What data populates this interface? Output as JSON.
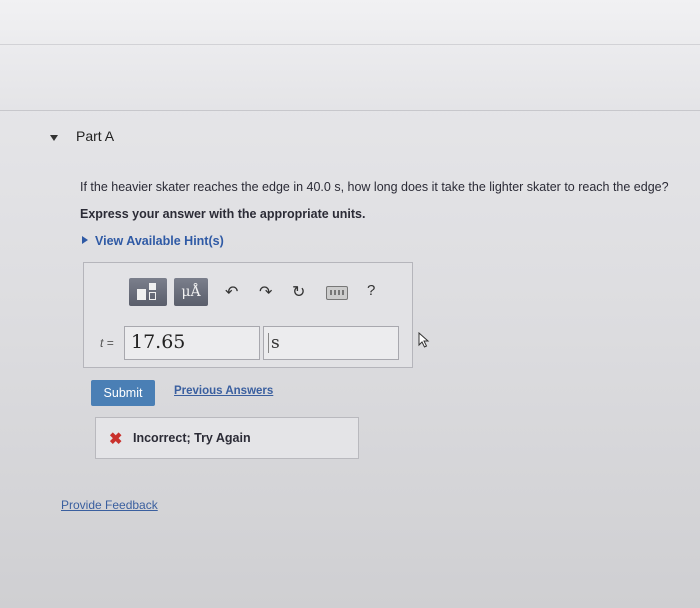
{
  "part": {
    "title": "Part A",
    "toggle_icon": "caret-down-icon"
  },
  "question": {
    "text": "If the heavier skater reaches the edge in 40.0 s, how long does it take the lighter skater to reach the edge?",
    "instruction": "Express your answer with the appropriate units.",
    "hint_label": "View Available Hint(s)"
  },
  "toolbar": {
    "units_label": "μÅ",
    "help_label": "?",
    "icons": [
      "template-icon",
      "units-icon",
      "undo-icon",
      "redo-icon",
      "reset-icon",
      "keyboard-icon",
      "help-icon"
    ]
  },
  "answer": {
    "variable_label": "t =",
    "value": "17.65",
    "unit": "s"
  },
  "actions": {
    "submit_label": "Submit",
    "previous_answers_label": "Previous Answers"
  },
  "feedback": {
    "icon": "incorrect-x-icon",
    "color": "#c9302c",
    "text": "Incorrect; Try Again"
  },
  "footer": {
    "provide_feedback_label": "Provide Feedback"
  },
  "colors": {
    "submit_bg": "#4a7fb5",
    "link": "#3a5f9f"
  }
}
